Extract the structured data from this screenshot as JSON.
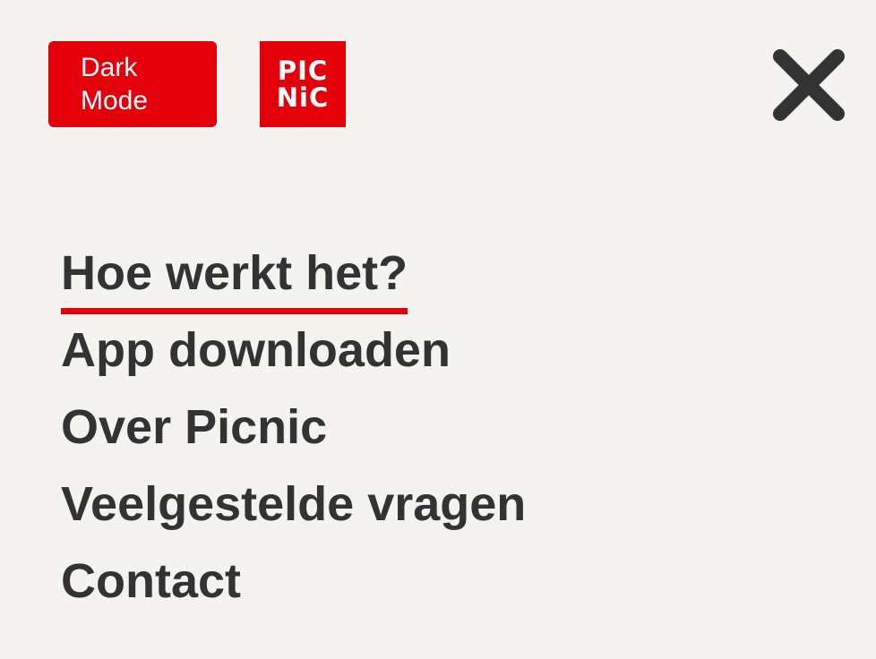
{
  "header": {
    "dark_mode_label_line1": "Dark",
    "dark_mode_label_line2": "Mode",
    "logo_line1": "PIC",
    "logo_line2": "NiC"
  },
  "nav": {
    "items": [
      {
        "label": "Hoe werkt het?",
        "active": true
      },
      {
        "label": "App downloaden",
        "active": false
      },
      {
        "label": "Over Picnic",
        "active": false
      },
      {
        "label": "Veelgestelde vragen",
        "active": false
      },
      {
        "label": "Contact",
        "active": false
      }
    ]
  },
  "icons": {
    "close": "close-icon"
  },
  "colors": {
    "brand_red": "#e3000b",
    "text": "#333333",
    "background": "#f5f3f0"
  }
}
